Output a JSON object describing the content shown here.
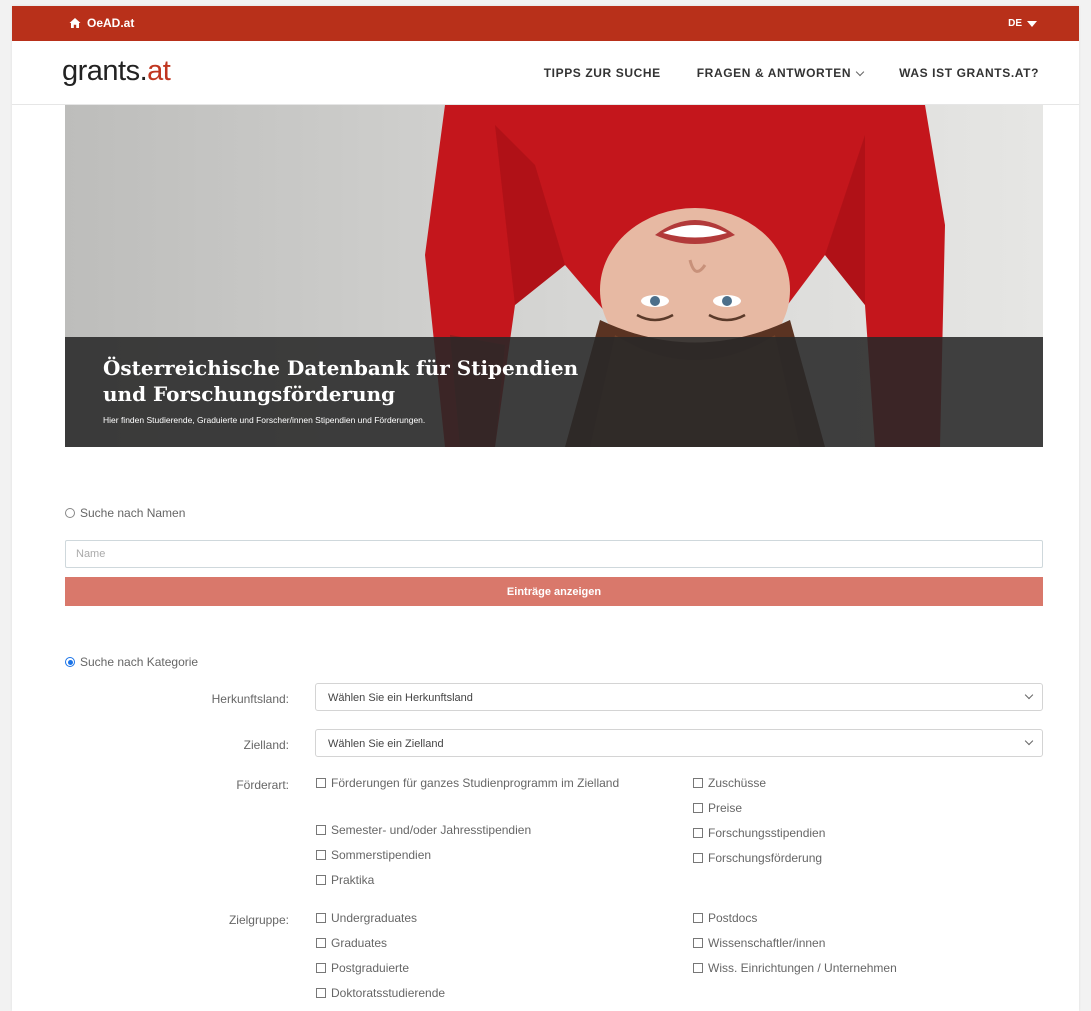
{
  "topbar": {
    "home_label": "OeAD.at",
    "lang_label": "DE"
  },
  "navbar": {
    "logo_main": "grants.",
    "logo_accent": "at",
    "items": [
      {
        "label": "TIPPS ZUR SUCHE"
      },
      {
        "label": "FRAGEN & ANTWORTEN"
      },
      {
        "label": "WAS IST GRANTS.AT?"
      }
    ]
  },
  "hero": {
    "title": "Österreichische Datenbank für Stipendien und Forschungsförderung",
    "subtitle": "Hier finden Studierende, Graduierte und Forscher/innen Stipendien und Förderungen."
  },
  "search_name": {
    "radio_label": "Suche nach Namen",
    "placeholder": "Name",
    "button_label": "Einträge anzeigen"
  },
  "search_category": {
    "radio_label": "Suche nach Kategorie",
    "herkunft_label": "Herkunftsland:",
    "herkunft_value": "Wählen Sie ein Herkunftsland",
    "ziel_label": "Zielland:",
    "ziel_value": "Wählen Sie ein Zielland",
    "foerderart_label": "Förderart:",
    "foerderart_left": [
      "Förderungen für ganzes Studienprogramm im Zielland",
      "Semester- und/oder Jahresstipendien",
      "Sommerstipendien",
      "Praktika"
    ],
    "foerderart_right": [
      "Zuschüsse",
      "Preise",
      "Forschungsstipendien",
      "Forschungsförderung"
    ],
    "zielgruppe_label": "Zielgruppe:",
    "zielgruppe_left": [
      "Undergraduates",
      "Graduates",
      "Postgraduierte",
      "Doktoratsstudierende"
    ],
    "zielgruppe_right": [
      "Postdocs",
      "Wissenschaftler/innen",
      "Wiss. Einrichtungen / Unternehmen"
    ]
  }
}
